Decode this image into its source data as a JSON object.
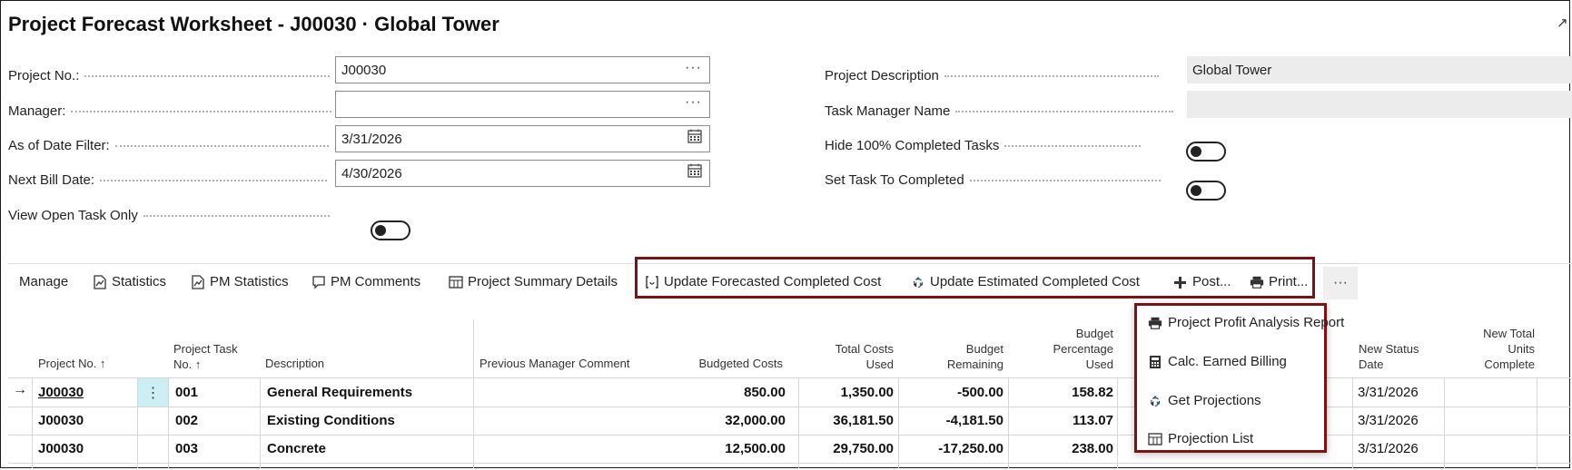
{
  "title": "Project Forecast Worksheet - J00030 · Global Tower",
  "fields": {
    "project_no": {
      "label": "Project No.:",
      "value": "J00030"
    },
    "manager": {
      "label": "Manager:",
      "value": ""
    },
    "as_of_date": {
      "label": "As of Date Filter:",
      "value": "3/31/2026"
    },
    "next_bill_date": {
      "label": "Next Bill Date:",
      "value": "4/30/2026"
    },
    "view_open_task": {
      "label": "View Open Task Only",
      "on": false
    },
    "project_description": {
      "label": "Project Description",
      "value": "Global Tower"
    },
    "task_manager_name": {
      "label": "Task Manager Name",
      "value": ""
    },
    "hide_completed": {
      "label": "Hide 100% Completed Tasks",
      "on": false
    },
    "set_task_completed": {
      "label": "Set Task To Completed",
      "on": false
    }
  },
  "actions": {
    "manage": "Manage",
    "statistics": "Statistics",
    "pm_statistics": "PM Statistics",
    "pm_comments": "PM Comments",
    "project_summary": "Project Summary Details",
    "update_forecasted": "Update Forecasted Completed Cost",
    "update_estimated": "Update Estimated Completed Cost",
    "post": "Post...",
    "print": "Print...",
    "more": "···"
  },
  "menu": {
    "items": [
      "Project Profit Analysis Report",
      "Calc. Earned Billing",
      "Get Projections",
      "Projection List"
    ]
  },
  "table": {
    "headers": {
      "project_no": "Project No. ↑",
      "task_no_1": "Project Task",
      "task_no_2": "No. ↑",
      "description": "Description",
      "prev_comment": "Previous Manager Comment",
      "budgeted": "Budgeted Costs",
      "total_used_1": "Total Costs",
      "total_used_2": "Used",
      "budget_rem_1": "Budget",
      "budget_rem_2": "Remaining",
      "budget_pct_1": "Budget",
      "budget_pct_2": "Percentage",
      "budget_pct_3": "Used",
      "status_date_1": "New Status",
      "status_date_2": "Date",
      "units_1": "New Total",
      "units_2": "Units",
      "units_3": "Complete"
    },
    "rows": [
      {
        "project": "J00030",
        "task": "001",
        "description": "General Requirements",
        "budgeted": "850.00",
        "used": "1,350.00",
        "remaining": "-500.00",
        "pct": "158.82",
        "date": "3/31/2026"
      },
      {
        "project": "J00030",
        "task": "002",
        "description": "Existing Conditions",
        "budgeted": "32,000.00",
        "used": "36,181.50",
        "remaining": "-4,181.50",
        "pct": "113.07",
        "date": "3/31/2026"
      },
      {
        "project": "J00030",
        "task": "003",
        "description": "Concrete",
        "budgeted": "12,500.00",
        "used": "29,750.00",
        "remaining": "-17,250.00",
        "pct": "238.00",
        "date": "3/31/2026"
      }
    ],
    "row_arrow": "→",
    "row_menu": "⋮"
  },
  "colors": {
    "accent_border": "#7a1216",
    "selected_cell": "#cdeef2"
  },
  "icons": [
    "expand-icon",
    "ellipsis-icon",
    "calendar-icon",
    "statistics-icon",
    "comment-icon",
    "table-icon",
    "refresh-icon",
    "recycle-icon",
    "post-icon",
    "printer-icon"
  ]
}
